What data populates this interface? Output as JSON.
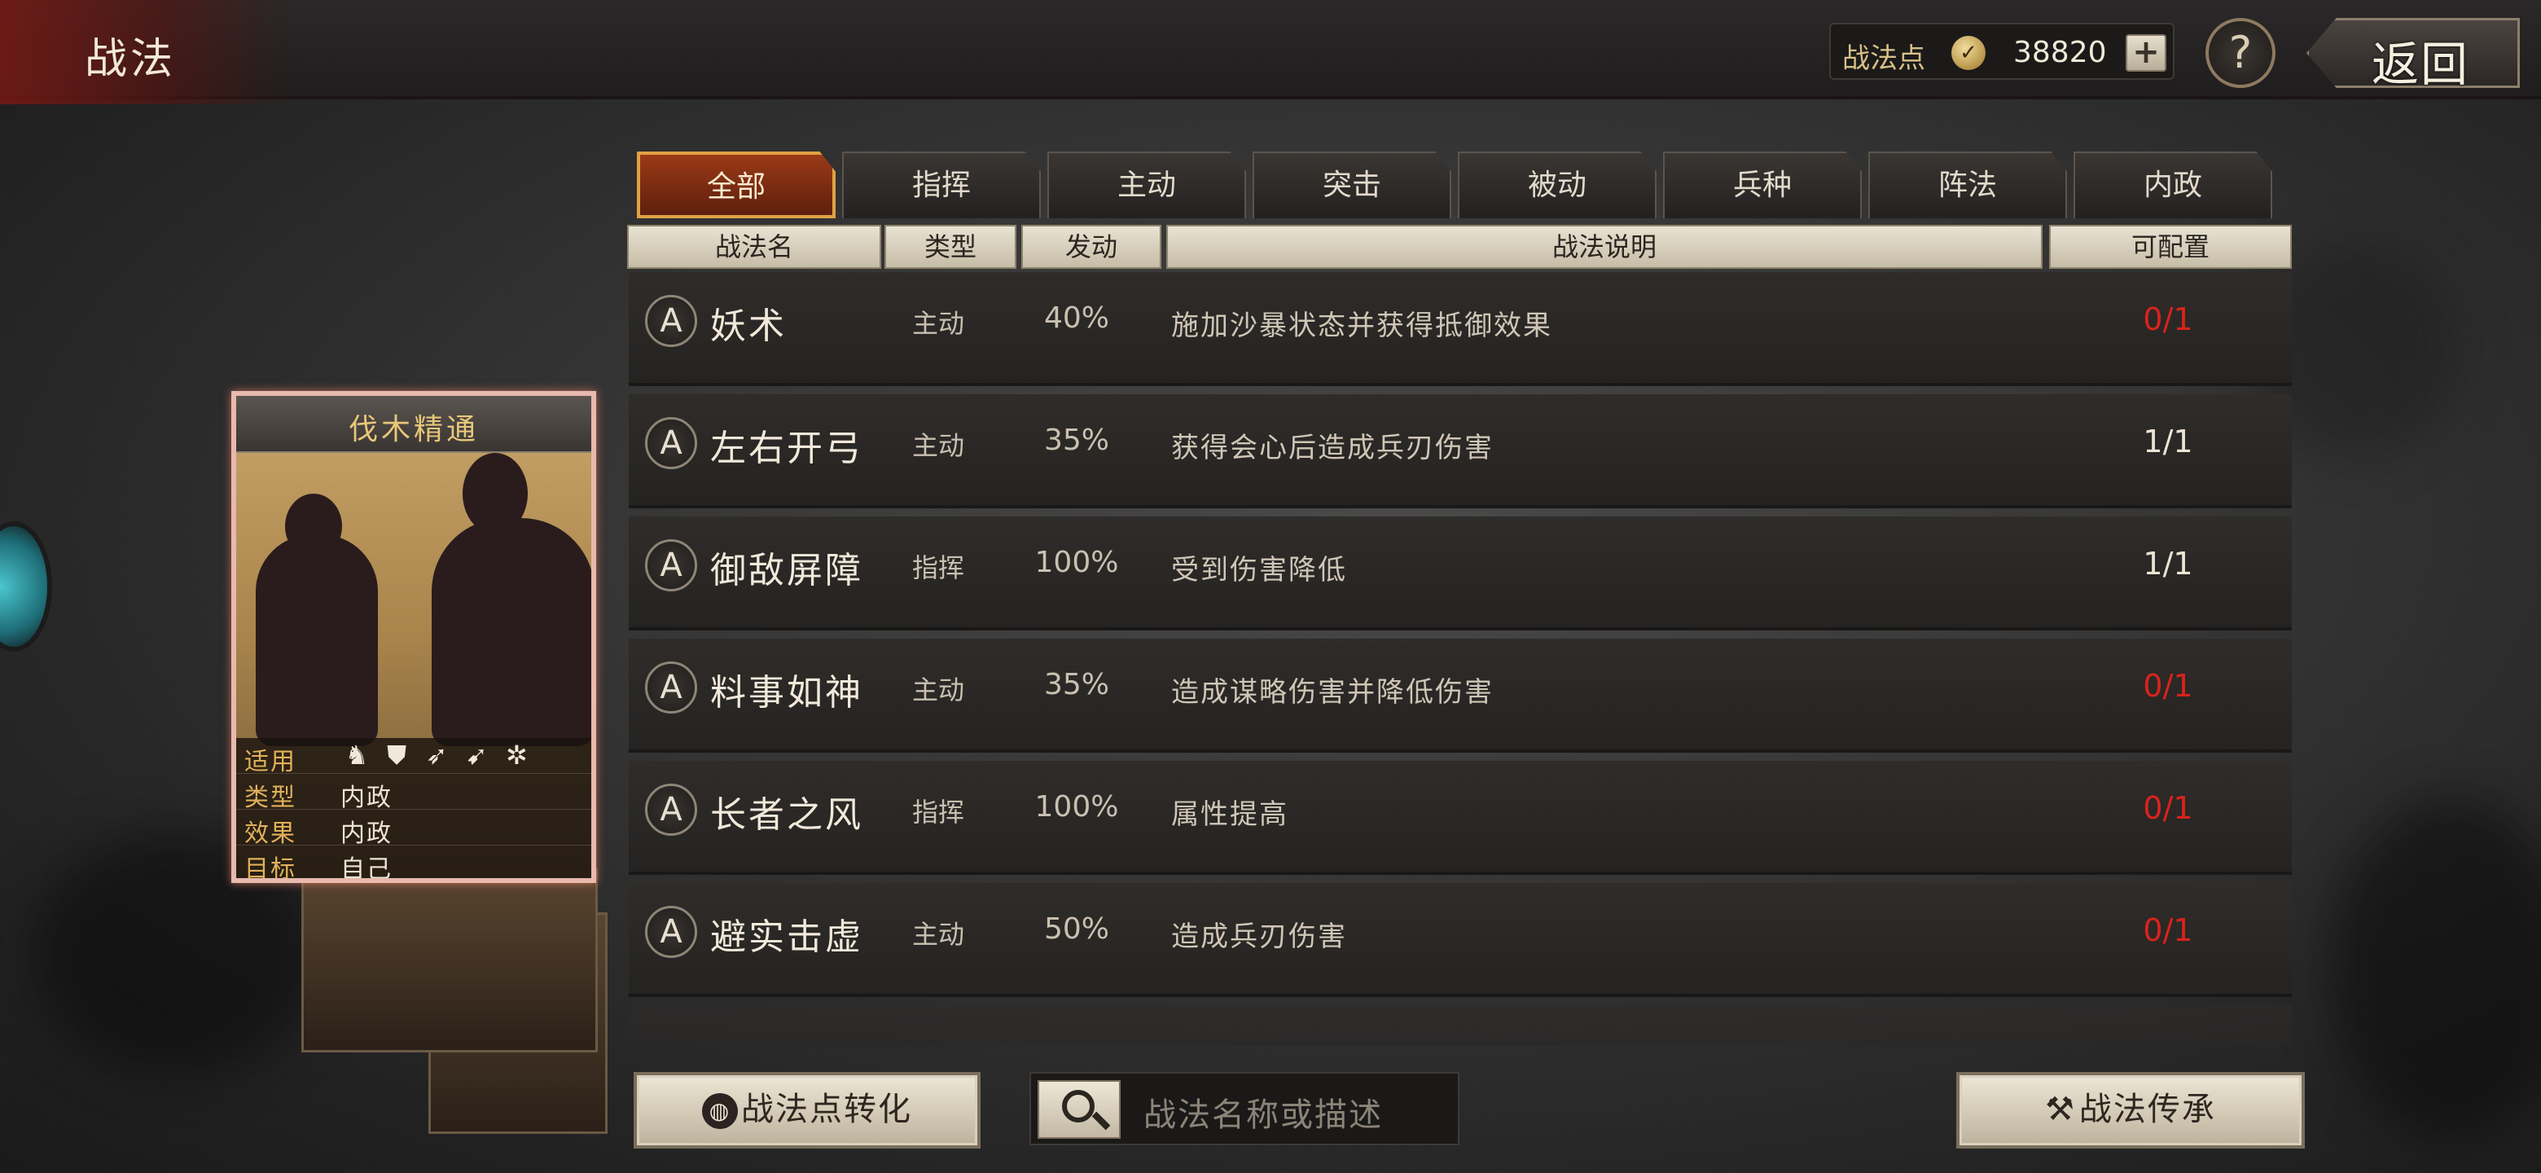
{
  "header": {
    "title": "战法",
    "points_label": "战法点",
    "points_coin": "✓",
    "points_value": "38820",
    "plus_label": "+",
    "help_label": "?",
    "back_label": "返回"
  },
  "tabs": [
    {
      "label": "全部",
      "active": true
    },
    {
      "label": "指挥",
      "active": false
    },
    {
      "label": "主动",
      "active": false
    },
    {
      "label": "突击",
      "active": false
    },
    {
      "label": "被动",
      "active": false
    },
    {
      "label": "兵种",
      "active": false
    },
    {
      "label": "阵法",
      "active": false
    },
    {
      "label": "内政",
      "active": false
    }
  ],
  "columns": {
    "name": "战法名",
    "type": "类型",
    "rate": "发动",
    "desc": "战法说明",
    "config": "可配置"
  },
  "rows": [
    {
      "icon": "A",
      "name": "妖术",
      "type": "主动",
      "rate": "40%",
      "desc": "施加沙暴状态并获得抵御效果",
      "config": "0/1",
      "config_red": true
    },
    {
      "icon": "A",
      "name": "左右开弓",
      "type": "主动",
      "rate": "35%",
      "desc": "获得会心后造成兵刃伤害",
      "config": "1/1",
      "config_red": false
    },
    {
      "icon": "A",
      "name": "御敌屏障",
      "type": "指挥",
      "rate": "100%",
      "desc": "受到伤害降低",
      "config": "1/1",
      "config_red": false
    },
    {
      "icon": "A",
      "name": "料事如神",
      "type": "主动",
      "rate": "35%",
      "desc": "造成谋略伤害并降低伤害",
      "config": "0/1",
      "config_red": true
    },
    {
      "icon": "A",
      "name": "长者之风",
      "type": "指挥",
      "rate": "100%",
      "desc": "属性提高",
      "config": "0/1",
      "config_red": true
    },
    {
      "icon": "A",
      "name": "避实击虚",
      "type": "主动",
      "rate": "50%",
      "desc": "造成兵刃伤害",
      "config": "0/1",
      "config_red": true
    }
  ],
  "card": {
    "title": "伐木精通",
    "apply_key": "适用",
    "troop_icons": [
      "♞",
      "⛊",
      "➶",
      "➹",
      "✲"
    ],
    "type_key": "类型",
    "type_val": "内政",
    "effect_key": "效果",
    "effect_val": "内政",
    "target_key": "目标",
    "target_val": "自己"
  },
  "footer": {
    "convert_label": "战法点转化",
    "convert_icon": "◍",
    "search_placeholder": "战法名称或描述",
    "inherit_label": "战法传承",
    "inherit_icon": "⚒"
  },
  "colors": {
    "accent_orange": "#e0a243",
    "red_text": "#d9231b",
    "gold_text": "#e8c77a"
  }
}
